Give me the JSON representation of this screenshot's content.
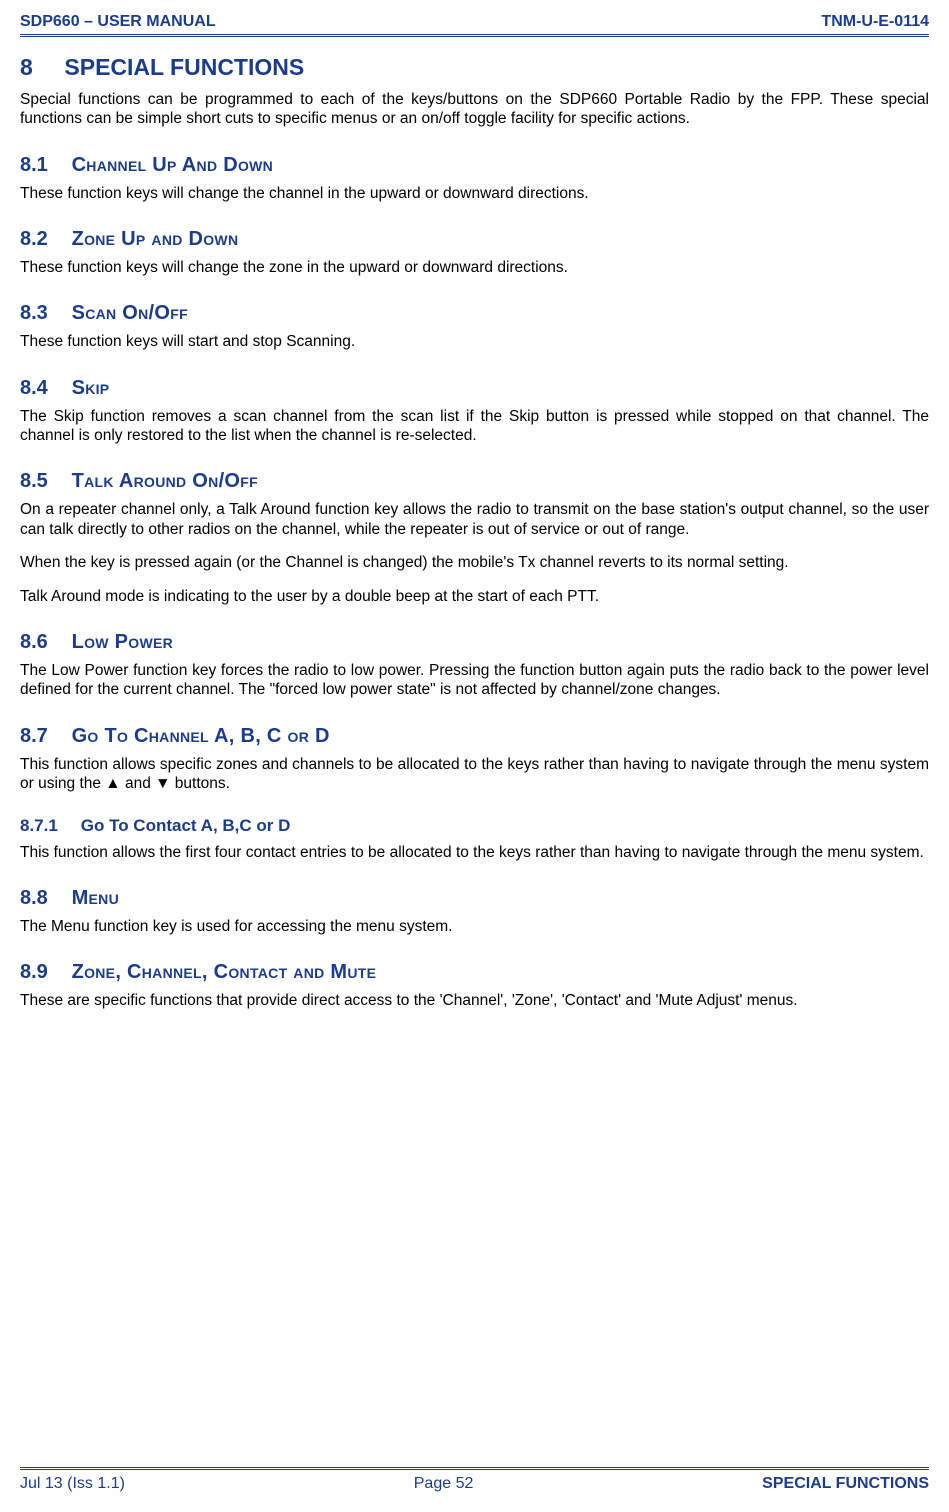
{
  "header": {
    "left": "SDP660 – USER MANUAL",
    "right": "TNM-U-E-0114"
  },
  "s8": {
    "num": "8",
    "title": "SPECIAL FUNCTIONS",
    "intro": "Special functions can be programmed to each of the keys/buttons on the SDP660 Portable Radio by the FPP.  These special functions can be simple short cuts to specific menus or an on/off toggle facility for specific actions."
  },
  "s81": {
    "num": "8.1",
    "title": "Channel Up And Down",
    "body": "These function keys will change the channel in the upward or downward directions."
  },
  "s82": {
    "num": "8.2",
    "title": "Zone Up and Down",
    "body": "These function keys will change the zone in the upward or downward directions."
  },
  "s83": {
    "num": "8.3",
    "title": "Scan On/Off",
    "body": "These function keys will start and stop Scanning."
  },
  "s84": {
    "num": "8.4",
    "title": "Skip",
    "body": "The Skip function removes a scan channel from the scan list if the Skip button is pressed while stopped on that channel.  The channel is only restored to the list when the channel is re-selected."
  },
  "s85": {
    "num": "8.5",
    "title": "Talk Around On/Off",
    "p1": "On a repeater channel only, a Talk Around function key allows the radio to transmit on the base station's output channel, so the user can talk directly to other radios on the channel, while the repeater is out of service or out of range.",
    "p2": "When the key is pressed again (or the Channel is changed) the mobile's Tx channel reverts to its normal setting.",
    "p3": "Talk Around mode is indicating to the user by a double beep at the start of each PTT."
  },
  "s86": {
    "num": "8.6",
    "title": "Low Power",
    "body": "The Low Power function key forces the radio to low power.  Pressing the function button again puts the radio back to the power level defined for the current channel.  The \"forced low power state\" is not affected by channel/zone changes."
  },
  "s87": {
    "num": "8.7",
    "title": "Go To Channel  A, B, C or D",
    "body": "This function allows specific zones and channels to be allocated to the keys rather than having to navigate through the menu system or using the ▲ and ▼ buttons."
  },
  "s871": {
    "num": "8.7.1",
    "title": "Go To Contact A, B,C or D",
    "body": "This function allows the first four contact entries to be allocated to the keys rather than having to navigate through the menu system."
  },
  "s88": {
    "num": "8.8",
    "title": "Menu",
    "body": "The Menu function key is used for accessing the menu system."
  },
  "s89": {
    "num": "8.9",
    "title": "Zone, Channel, Contact and Mute",
    "body": "These are specific functions that provide direct access to the 'Channel', 'Zone', 'Contact' and 'Mute Adjust' menus."
  },
  "footer": {
    "left": "Jul 13 (Iss 1.1)",
    "center": "Page 52",
    "right": "SPECIAL FUNCTIONS"
  }
}
